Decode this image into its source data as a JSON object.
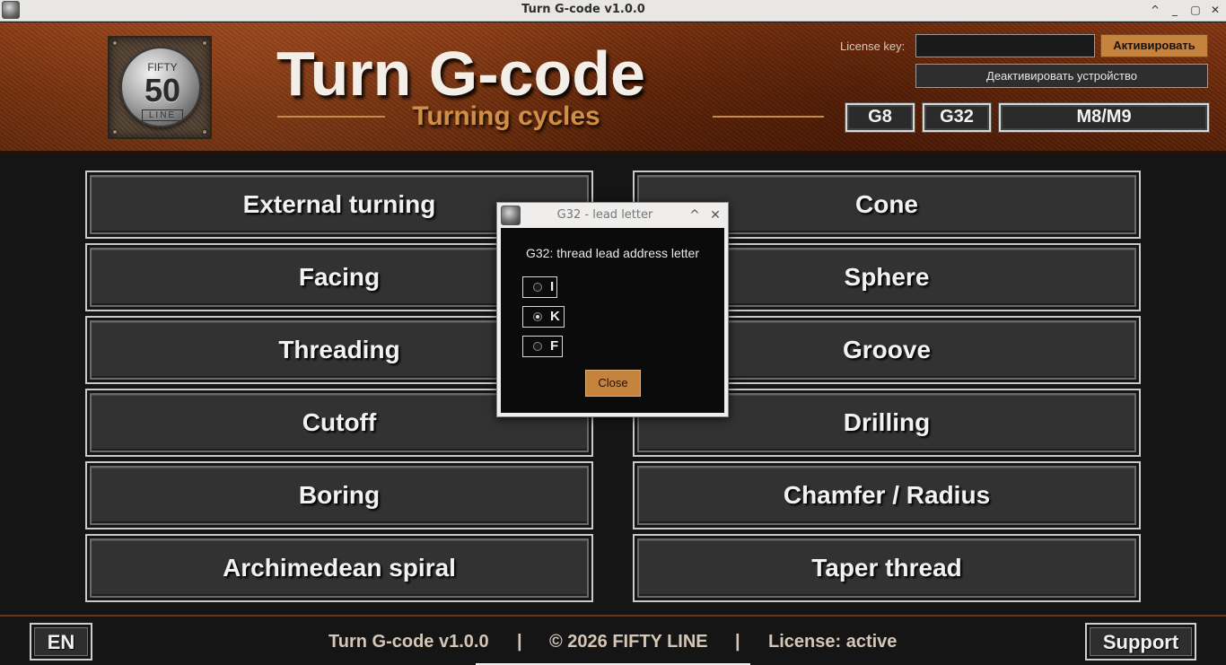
{
  "window": {
    "title": "Turn G-code v1.0.0",
    "icon": "app-coin-icon",
    "controls": {
      "minimize": "_",
      "maximize": "▢",
      "restore": "^"
    }
  },
  "header": {
    "logo": {
      "top_text": "FIFTY",
      "number": "50",
      "bottom_text": "LINE"
    },
    "title": "Turn G-code",
    "subtitle": "Turning cycles",
    "license": {
      "label": "License key:",
      "value": "",
      "activate_label": "Активировать",
      "deactivate_label": "Деактивировать устройство"
    },
    "modes": [
      "G8",
      "G32",
      "M8/M9"
    ]
  },
  "cycles": {
    "left": [
      "External turning",
      "Facing",
      "Threading",
      "Cutoff",
      "Boring",
      "Archimedean spiral"
    ],
    "right": [
      "Cone",
      "Sphere",
      "Groove",
      "Drilling",
      "Chamfer / Radius",
      "Taper thread"
    ]
  },
  "footer": {
    "language": "EN",
    "version": "Turn G-code v1.0.0",
    "sep": "|",
    "copyright": "© 2026 FIFTY LINE",
    "license_status": "License: active",
    "support": "Support"
  },
  "dialog": {
    "title": "G32 - lead letter",
    "message": "G32: thread lead address letter",
    "options": [
      "I",
      "K",
      "F"
    ],
    "selected": "K",
    "close_label": "Close",
    "title_controls": {
      "roll": "^",
      "close": "✕"
    }
  },
  "colors": {
    "accent": "#c6833d",
    "header_rust": "#7a3211",
    "button_bg": "#323232"
  }
}
